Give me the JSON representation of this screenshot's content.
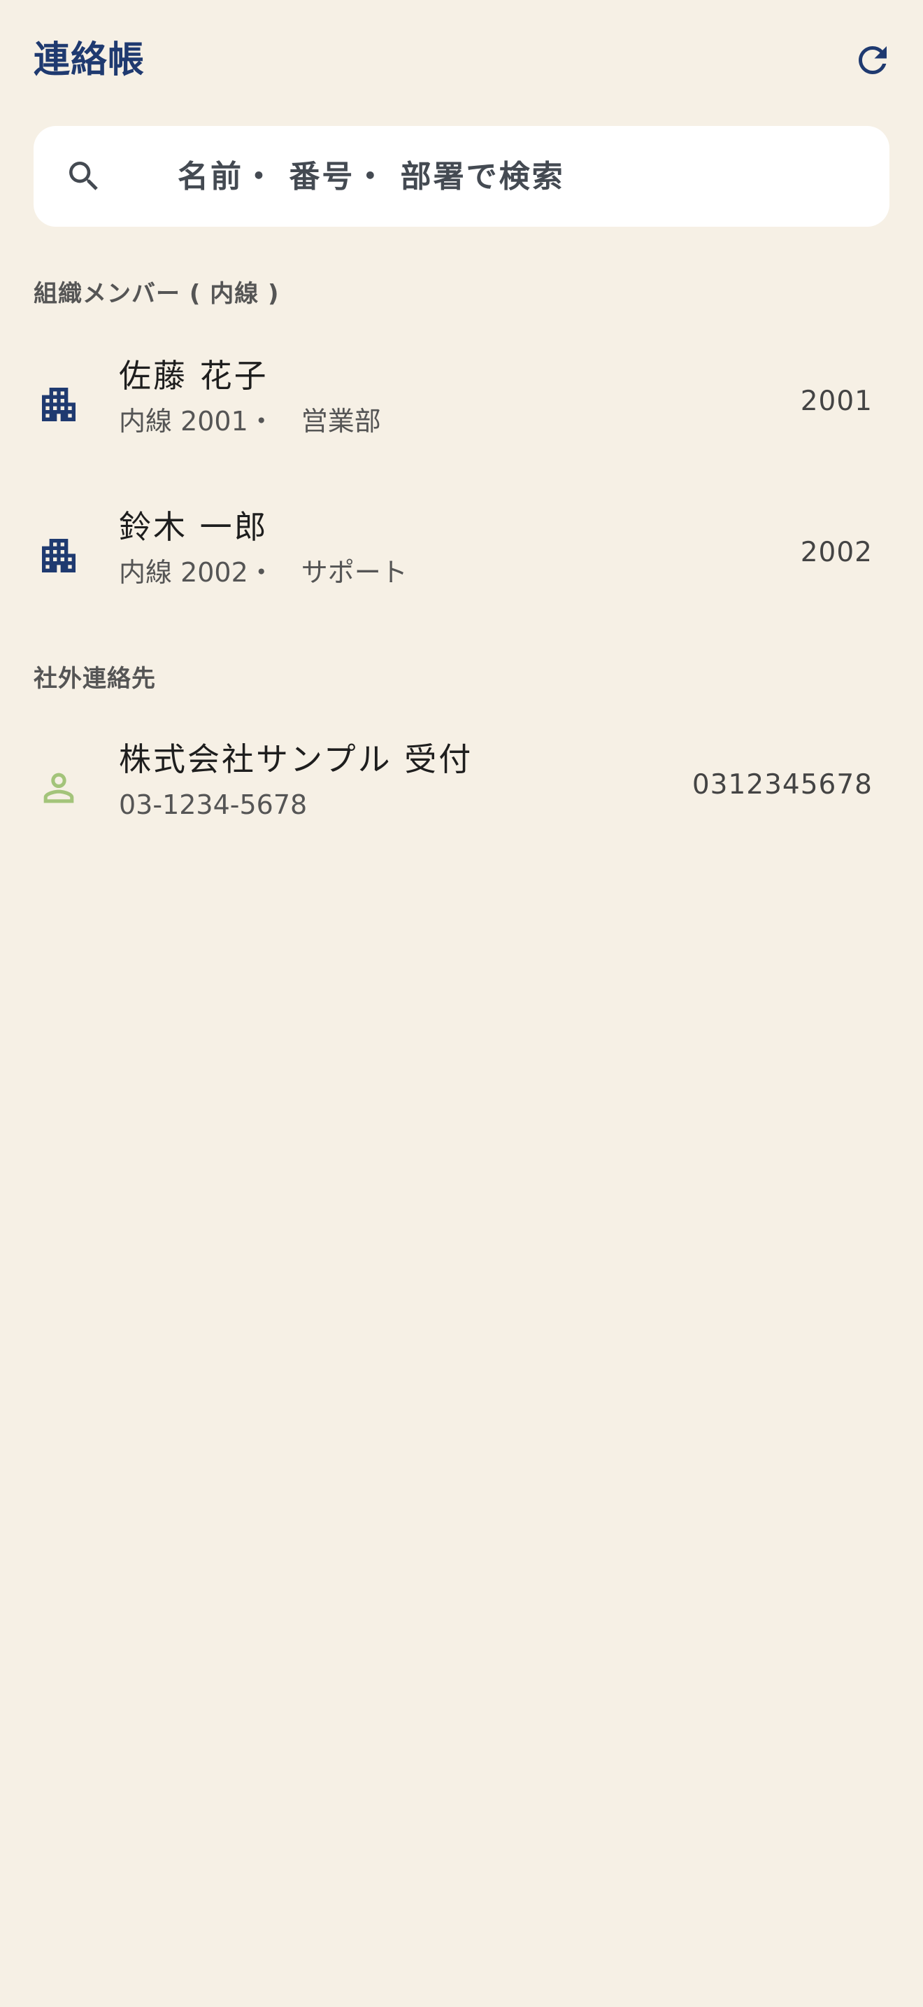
{
  "header": {
    "title": "連絡帳",
    "refresh_icon": "refresh-icon",
    "accent_color": "#1f3a70"
  },
  "search": {
    "placeholder": "名前・ 番号・ 部署で検索",
    "value": "",
    "icon": "search-icon"
  },
  "sections": {
    "internal": {
      "label": "組織メンバー ( 内線 )",
      "items": [
        {
          "name": "佐藤 花子",
          "subtitle": "内線 2001・　営業部",
          "number": "2001",
          "icon": "building-icon"
        },
        {
          "name": "鈴木 一郎",
          "subtitle": "内線 2002・　サポート",
          "number": "2002",
          "icon": "building-icon"
        }
      ]
    },
    "external": {
      "label": "社外連絡先",
      "items": [
        {
          "name": "株式会社サンプル 受付",
          "subtitle": "03-1234-5678",
          "number": "0312345678",
          "icon": "person-icon"
        }
      ]
    }
  },
  "colors": {
    "background": "#f6f0e5",
    "building_icon": "#1f3a70",
    "person_icon": "#a3c47a"
  }
}
